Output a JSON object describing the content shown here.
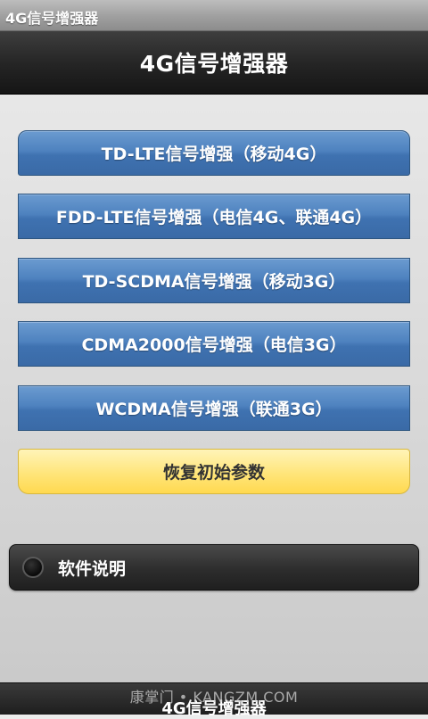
{
  "status_bar": {
    "title": "4G信号增强器"
  },
  "title_bar": {
    "title": "4G信号增强器"
  },
  "buttons": [
    {
      "label": "TD-LTE信号增强（移动4G）"
    },
    {
      "label": "FDD-LTE信号增强（电信4G、联通4G）"
    },
    {
      "label": "TD-SCDMA信号增强（移动3G）"
    },
    {
      "label": "CDMA2000信号增强（电信3G）"
    },
    {
      "label": "WCDMA信号增强（联通3G）"
    }
  ],
  "reset_button": {
    "label": "恢复初始参数"
  },
  "software_info": {
    "label": "软件说明",
    "checked": false
  },
  "bottom_bar": {
    "label": "4G信号增强器"
  },
  "watermark": {
    "text": "康掌门 • KANGZM.COM"
  },
  "colors": {
    "button_blue": "#4a7cbb",
    "reset_yellow": "#ffe57a",
    "toggle_dark": "#2d2d2d",
    "title_bar": "#262626"
  }
}
